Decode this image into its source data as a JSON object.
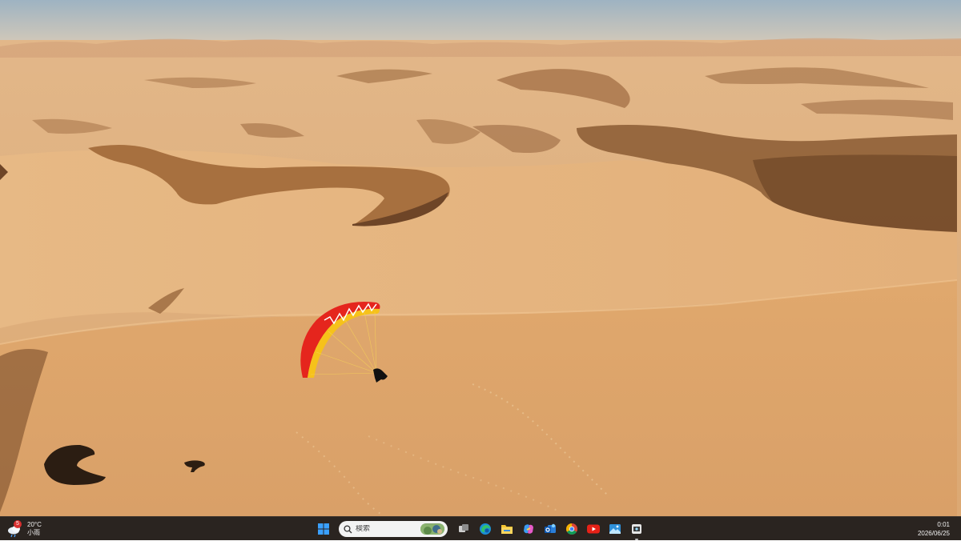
{
  "wallpaper": {
    "description_icon": "desert-dunes-paraglider-wallpaper"
  },
  "taskbar": {
    "weather": {
      "temperature": "20°C",
      "condition": "小雨",
      "badge": "5",
      "icon": "cloud-rain-icon"
    },
    "start": {
      "icon": "windows-start-icon"
    },
    "search": {
      "placeholder": "検索",
      "icon": "search-icon"
    },
    "apps": [
      {
        "name": "task-view",
        "icon": "task-view-icon"
      },
      {
        "name": "edge",
        "icon": "edge-icon"
      },
      {
        "name": "file-explorer",
        "icon": "folder-icon"
      },
      {
        "name": "copilot",
        "icon": "copilot-icon"
      },
      {
        "name": "outlook",
        "icon": "outlook-icon"
      },
      {
        "name": "chrome",
        "icon": "chrome-icon"
      },
      {
        "name": "youtube",
        "icon": "youtube-icon"
      },
      {
        "name": "photos",
        "icon": "photos-icon"
      },
      {
        "name": "snipping-tool",
        "icon": "app-icon"
      }
    ],
    "clock": {
      "time": "0:01",
      "date": "2026/06/25"
    }
  },
  "colors": {
    "taskbar_bg": "#2a2420",
    "sand_light": "#e8b882",
    "sand_mid": "#d9a066",
    "sand_shadow": "#8a5a32",
    "sky": "#b9c8d2",
    "canopy_red": "#e5251d",
    "canopy_yellow": "#f6c21a"
  }
}
